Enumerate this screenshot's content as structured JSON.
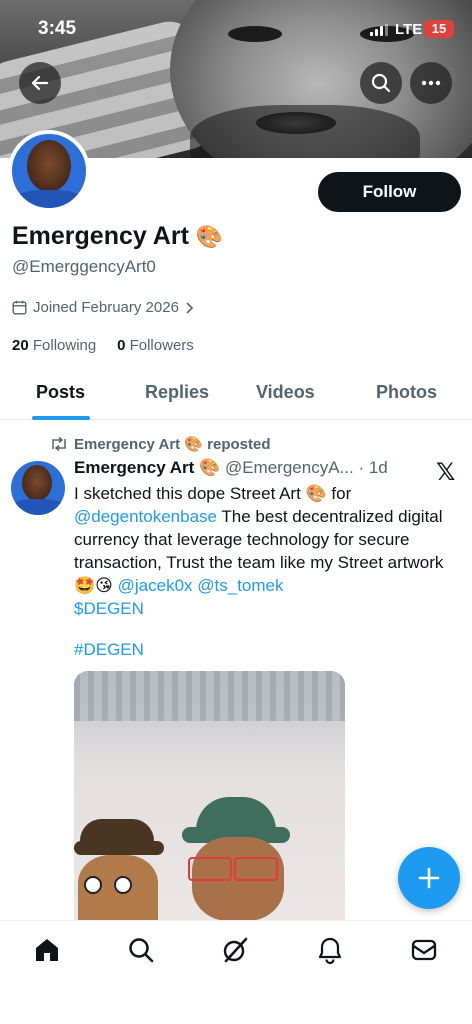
{
  "status_bar": {
    "time": "3:45",
    "network": "LTE",
    "battery": "15"
  },
  "header": {
    "back_icon": "arrow-left-icon",
    "search_icon": "search-icon",
    "more_icon": "more-icon"
  },
  "profile": {
    "follow_label": "Follow",
    "display_name": "Emergency Art",
    "name_emoji": "🎨",
    "handle": "@EmerggencyArt0",
    "joined": "Joined February 2026",
    "following_count": "20",
    "following_label": "Following",
    "followers_count": "0",
    "followers_label": "Followers"
  },
  "tabs": [
    {
      "label": "Posts",
      "active": true
    },
    {
      "label": "Replies",
      "active": false
    },
    {
      "label": "Videos",
      "active": false
    },
    {
      "label": "Photos",
      "active": false
    }
  ],
  "post": {
    "repost_label": "Emergency Art 🎨 reposted",
    "author_name": "Emergency Art",
    "author_emoji": "🎨",
    "author_handle": "@EmergencyA...",
    "time": "· 1d",
    "source_logo": "𝕏",
    "text_1": "I sketched this dope Street Art 🎨 for",
    "mention_1": "@degentokenbase",
    "text_2": " The best decentralized digital currency that leverage technology for secure transaction, Trust the team like my Street artwork 🤩😘 ",
    "mention_2": "@jacek0x",
    "mention_3": "@ts_tomek",
    "cashtag": "$DEGEN",
    "hashtag": "#DEGEN"
  },
  "nav": [
    "home-icon",
    "search-icon",
    "grok-icon",
    "notifications-icon",
    "messages-icon"
  ],
  "colors": {
    "accent": "#1d9bf0",
    "text": "#0f1419",
    "secondary": "#536471"
  }
}
